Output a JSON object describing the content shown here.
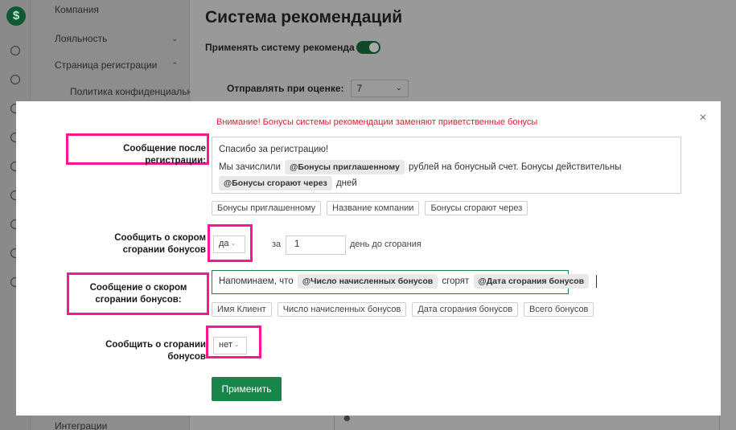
{
  "sidebar": {
    "items": [
      {
        "label": "Компания"
      },
      {
        "label": "Лояльность"
      },
      {
        "label": "Страница регистрации"
      },
      {
        "label": "Политика конфиденциальност"
      },
      {
        "label": "Интеграции"
      }
    ]
  },
  "main": {
    "title": "Система рекомендаций",
    "apply_system_label": "Применять систему рекоменда",
    "send_on_rating_label": "Отправлять при оценке:",
    "send_on_rating_value": "7"
  },
  "modal": {
    "warning": "Внимание! Бонусы системы рекомендации заменяют приветственные бонусы",
    "after_reg": {
      "label": "Сообщение после регистрации:",
      "line1": "Спасибо за регистрацию!",
      "line2_a": "Мы зачислили",
      "chip1": "@Бонусы приглашенному",
      "line2_b": "рублей на бонусный счет. Бонусы действительны",
      "chip2": "@Бонусы сгорают через",
      "line3_b": "дней",
      "tags": [
        "Бонусы приглашенному",
        "Название компании",
        "Бонусы сгорают через"
      ]
    },
    "notify_soon": {
      "label": "Сообщить о скором сгорании бонусов",
      "value": "да",
      "za_label": "за",
      "days_value": "1",
      "days_suffix": "день до сгорания"
    },
    "soon_msg": {
      "label": "Сообщение о скором сгорании бонусов:",
      "text_a": "Напоминаем, что",
      "chip1": "@Число начисленных бонусов",
      "text_b": "сгорят",
      "chip2": "@Дата сгорания бонусов",
      "tags": [
        "Имя Клиент",
        "Число начисленных бонусов",
        "Дата сгорания бонусов",
        "Всего бонусов"
      ]
    },
    "notify_burn": {
      "label": "Сообщить о сгорании бонусов",
      "value": "нет"
    },
    "apply_button": "Применить"
  },
  "colors": {
    "accent": "#18864b",
    "warning": "#d9232d",
    "highlight": "#ff1493"
  }
}
